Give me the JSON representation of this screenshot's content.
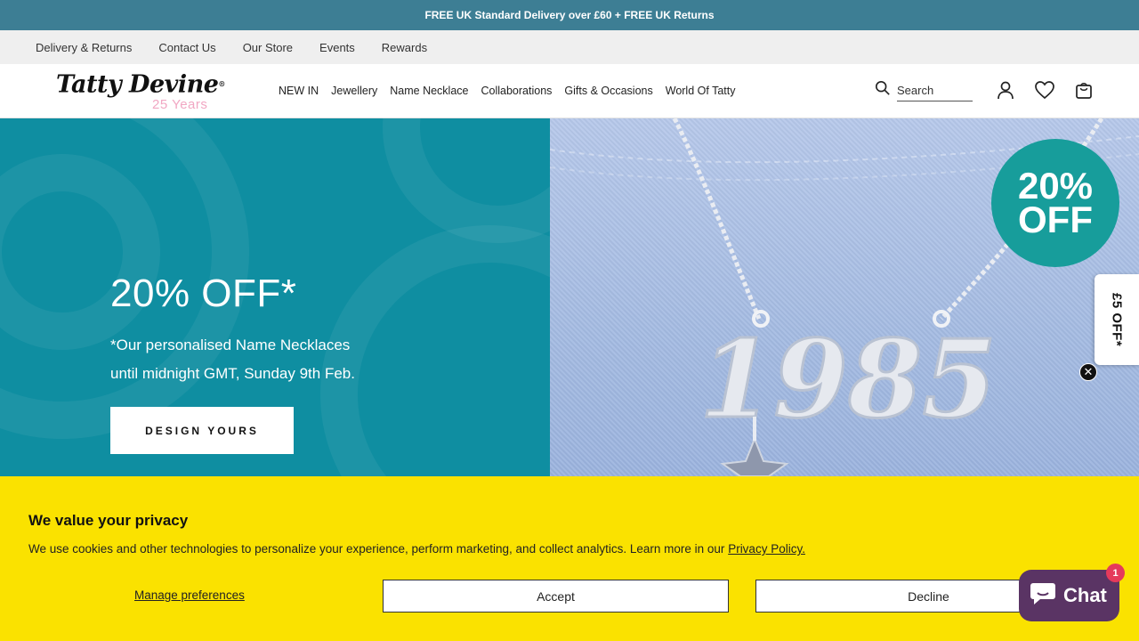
{
  "announcement": "FREE UK Standard Delivery over £60 + FREE UK Returns",
  "utility_links": [
    "Delivery & Returns",
    "Contact Us",
    "Our Store",
    "Events",
    "Rewards"
  ],
  "logo": {
    "name": "Tatty Devine",
    "reg": "®",
    "sub": "25 Years"
  },
  "main_nav": [
    "NEW IN",
    "Jewellery",
    "Name Necklace",
    "Collaborations",
    "Gifts & Occasions",
    "World Of Tatty"
  ],
  "search": {
    "placeholder": "Search"
  },
  "header_icons": [
    "account-icon",
    "wishlist-heart-icon",
    "cart-bag-icon"
  ],
  "hero": {
    "title": "20% OFF*",
    "line1": "*Our personalised Name Necklaces",
    "line2": "until midnight GMT, Sunday 9th Feb.",
    "cta": "DESIGN YOURS",
    "badge_line1": "20%",
    "badge_line2": "OFF",
    "necklace_text": "1985",
    "colors": {
      "teal": "#0f8ea1",
      "badge": "#179d9b",
      "denim": "#a9bfe3"
    }
  },
  "side_tab": {
    "label": "£5 OFF*",
    "close": "✕"
  },
  "cookie": {
    "title": "We value your privacy",
    "text": "We use cookies and other technologies to personalize your experience, perform marketing, and collect analytics. Learn more in our",
    "link": "Privacy Policy.",
    "manage": "Manage preferences",
    "accept": "Accept",
    "decline": "Decline",
    "background": "#fae200"
  },
  "chat": {
    "label": "Chat",
    "badge": "1",
    "color": "#5a3464"
  }
}
